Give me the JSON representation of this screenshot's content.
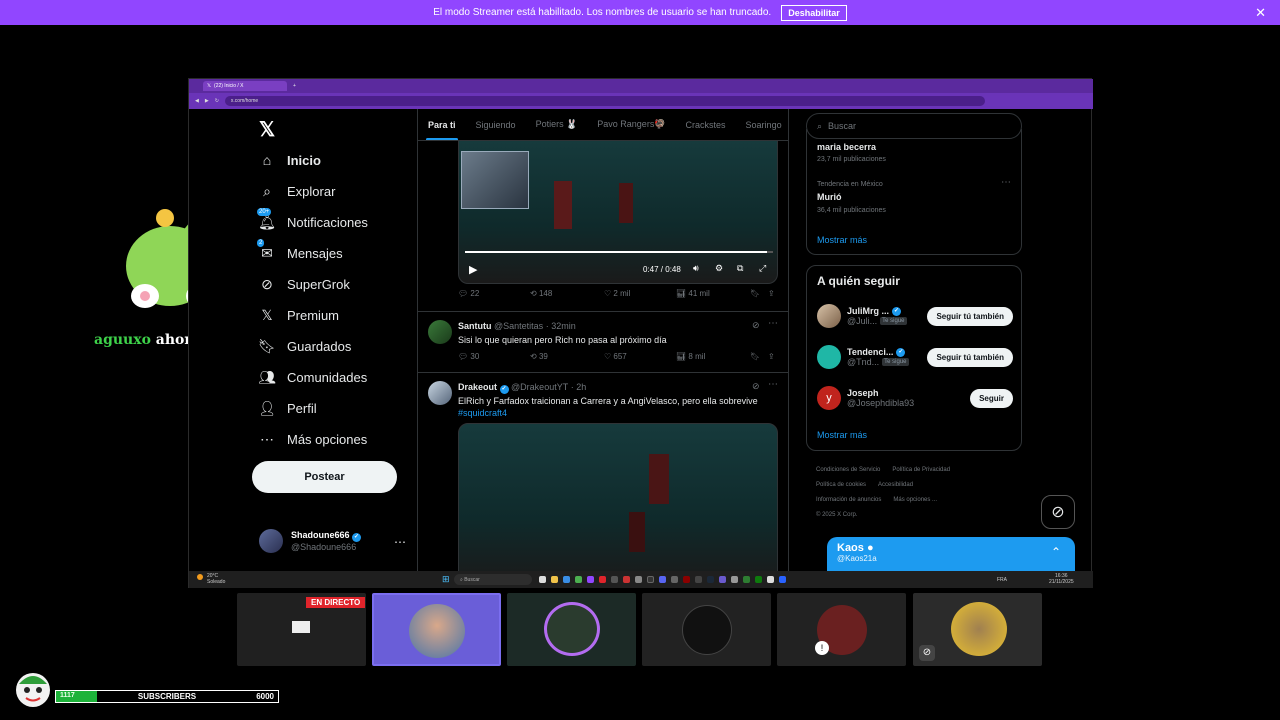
{
  "banner": {
    "text": "El modo Streamer está habilitado. Los nombres de usuario se han truncado.",
    "button": "Deshabilitar"
  },
  "follow_alert": {
    "username": "aguuxo",
    "message": "ahora me sigue"
  },
  "browser": {
    "tab_title": "(22) Inicio / X",
    "url": "x.com/home"
  },
  "x": {
    "nav": [
      {
        "label": "Inicio",
        "icon": "home-icon"
      },
      {
        "label": "Explorar",
        "icon": "search-icon"
      },
      {
        "label": "Notificaciones",
        "icon": "bell-icon",
        "badge": "20+"
      },
      {
        "label": "Mensajes",
        "icon": "mail-icon",
        "badge": "2"
      },
      {
        "label": "SuperGrok",
        "icon": "grok-icon"
      },
      {
        "label": "Premium",
        "icon": "x-icon"
      },
      {
        "label": "Guardados",
        "icon": "bookmark-icon"
      },
      {
        "label": "Comunidades",
        "icon": "communities-icon"
      },
      {
        "label": "Perfil",
        "icon": "person-icon"
      },
      {
        "label": "Más opciones",
        "icon": "more-circle-icon"
      }
    ],
    "post_button": "Postear",
    "account": {
      "name": "Shadoune666",
      "handle": "@Shadoune666"
    },
    "tabs": [
      "Para ti",
      "Siguiendo",
      "Potiers 🐰",
      "Pavo Rangers🦃",
      "Crackstes",
      "Soaringo"
    ],
    "video1": {
      "time": "0:47 / 0:48",
      "progress": 0.98,
      "stats": {
        "replies": "22",
        "reposts": "148",
        "likes": "2 mil",
        "views": "41 mil"
      }
    },
    "tweet2": {
      "name": "Santutu",
      "handle": "@Santetitas",
      "time": "· 32min",
      "text": "Sisi lo que quieran pero Rich no pasa al próximo día",
      "stats": {
        "replies": "30",
        "reposts": "39",
        "likes": "657",
        "views": "8 mil"
      }
    },
    "tweet3": {
      "name": "Drakeout",
      "handle": "@DrakeoutYT",
      "time": "· 2h",
      "text": "ElRich y Farfadox traicionan a Carrera y a AngiVelasco, pero ella sobrevive",
      "hashtag": "#squidcraft4"
    },
    "search_placeholder": "Buscar",
    "trends": [
      {
        "label": "",
        "name": "maria becerra",
        "count": "23,7 mil publicaciones"
      },
      {
        "label": "Tendencia en México",
        "name": "Murió",
        "count": "36,4 mil publicaciones"
      }
    ],
    "trends_more": "Mostrar más",
    "who_title": "A quién seguir",
    "who": [
      {
        "name": "JuliMrg ...",
        "handle": "@Juli...",
        "tag": "Te sigue",
        "button": "Seguir tú también"
      },
      {
        "name": "Tendenci...",
        "handle": "@Tnd...",
        "tag": "Te sigue",
        "button": "Seguir tú también"
      },
      {
        "name": "Joseph",
        "handle": "@Josephdibla93",
        "tag": "",
        "button": "Seguir"
      }
    ],
    "who_more": "Mostrar más",
    "footer": [
      "Condiciones de Servicio",
      "Política de Privacidad",
      "Política de cookies",
      "Accesibilidad",
      "Información de anuncios",
      "Más opciones ...",
      "© 2025 X Corp."
    ],
    "chat": {
      "name": "Kaos",
      "handle": "@Kaos21a"
    }
  },
  "taskbar": {
    "weather": "20°C",
    "weather_sub": "Soleado",
    "search": "Buscar",
    "lang": "FRA",
    "time": "16:36",
    "date": "21/11/2025"
  },
  "stream": {
    "live_badge": "EN DIRECTO"
  },
  "subscribers": {
    "current": "1117",
    "label": "SUBSCRIBERS",
    "goal": "6000",
    "progress": 0.186
  },
  "colors": {
    "banner": "#9146ff",
    "accent": "#1d9bf0",
    "sub_fill": "#1db33a"
  }
}
